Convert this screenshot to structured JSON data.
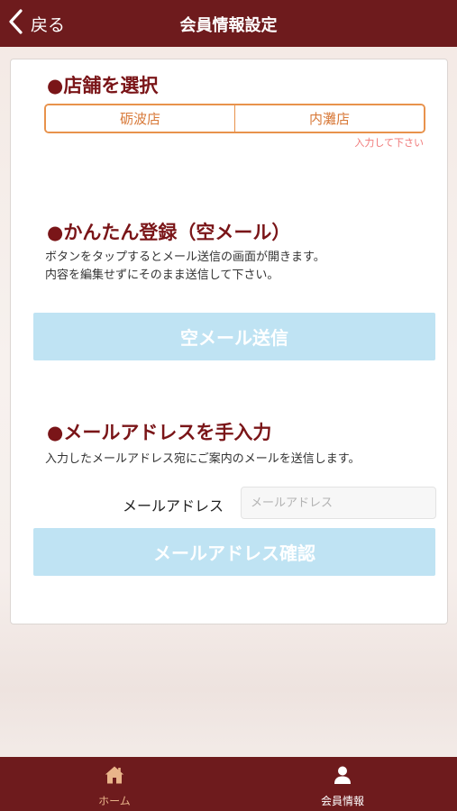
{
  "header": {
    "back_label": "戻る",
    "title": "会員情報設定"
  },
  "store_section": {
    "title": "●店舗を選択",
    "options": [
      "砺波店",
      "内灘店"
    ],
    "hint": "入力して下さい"
  },
  "easy_section": {
    "title": "●かんたん登録（空メール）",
    "desc_line1": "ボタンをタップするとメール送信の画面が開きます。",
    "desc_line2": "内容を編集せずにそのまま送信して下さい。",
    "button_label": "空メール送信"
  },
  "manual_section": {
    "title": "●メールアドレスを手入力",
    "desc": "入力したメールアドレス宛にご案内のメールを送信します。",
    "field_label": "メールアドレス",
    "field_placeholder": "メールアドレス",
    "field_value": "",
    "button_label": "メールアドレス確認"
  },
  "footer": {
    "home_label": "ホーム",
    "member_label": "会員情報"
  },
  "colors": {
    "brand": "#6e1b1d",
    "accent": "#e8924c",
    "button": "#bfe3f3",
    "hint": "#f07878"
  }
}
